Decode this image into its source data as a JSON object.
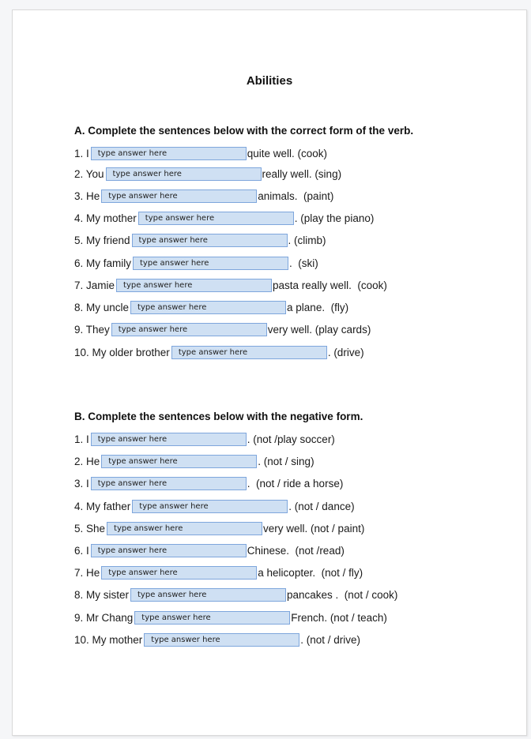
{
  "document": {
    "title": "Abilities",
    "field_placeholder": "type answer here"
  },
  "section_a": {
    "heading": "A. Complete the sentences below with the correct form of the verb.",
    "items": [
      {
        "prefix": "1. I",
        "suffix": "quite well. (cook)",
        "value": ""
      },
      {
        "prefix": "2. You",
        "suffix": "really well. (sing)",
        "value": ""
      },
      {
        "prefix": "3. He",
        "suffix": "animals.  (paint)",
        "value": ""
      },
      {
        "prefix": "4. My mother",
        "suffix": ". (play the piano)",
        "value": ""
      },
      {
        "prefix": "5. My friend",
        "suffix": ". (climb)",
        "value": ""
      },
      {
        "prefix": "6. My family",
        "suffix": ".  (ski)",
        "value": ""
      },
      {
        "prefix": "7. Jamie",
        "suffix": "pasta really well.  (cook)",
        "value": ""
      },
      {
        "prefix": "8. My uncle",
        "suffix": "a plane.  (fly)",
        "value": ""
      },
      {
        "prefix": "9. They",
        "suffix": "very well. (play cards)",
        "value": ""
      },
      {
        "prefix": "10. My older brother",
        "suffix": ". (drive)",
        "value": ""
      }
    ]
  },
  "section_b": {
    "heading": "B. Complete the sentences below with the negative form.",
    "items": [
      {
        "prefix": "1. I",
        "suffix": ". (not /play soccer)",
        "value": ""
      },
      {
        "prefix": "2. He",
        "suffix": ". (not / sing)",
        "value": ""
      },
      {
        "prefix": "3. I",
        "suffix": ".  (not / ride a horse)",
        "value": ""
      },
      {
        "prefix": "4. My father",
        "suffix": ". (not / dance)",
        "value": ""
      },
      {
        "prefix": "5. She",
        "suffix": "very well. (not / paint)",
        "value": ""
      },
      {
        "prefix": "6. I",
        "suffix": "Chinese.  (not /read)",
        "value": ""
      },
      {
        "prefix": "7. He",
        "suffix": "a helicopter.  (not / fly)",
        "value": ""
      },
      {
        "prefix": "8. My sister",
        "suffix": "pancakes .  (not / cook)",
        "value": ""
      },
      {
        "prefix": "9. Mr Chang",
        "suffix": "French. (not / teach)",
        "value": ""
      },
      {
        "prefix": "10. My mother",
        "suffix": ". (not / drive)",
        "value": ""
      }
    ]
  }
}
